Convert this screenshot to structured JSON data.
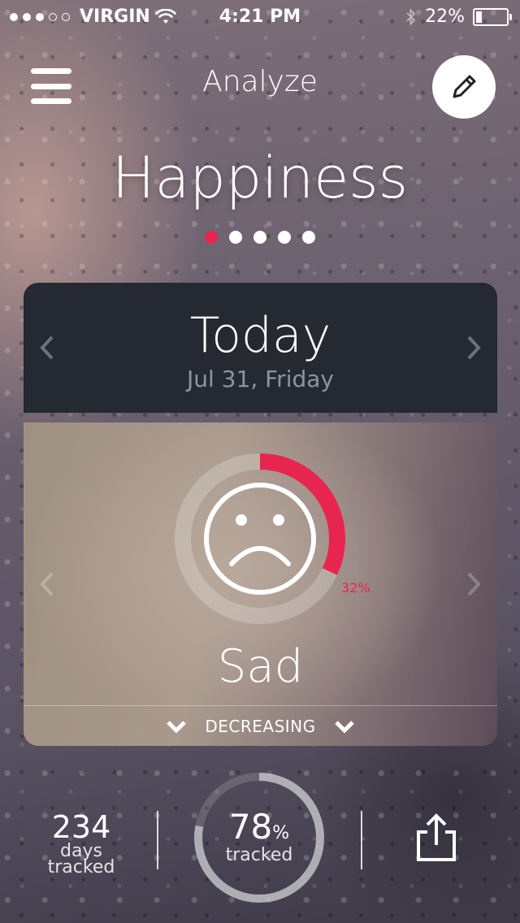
{
  "status": {
    "carrier": "VIRGIN",
    "time": "4:21 PM",
    "battery": "22%",
    "battery_level": 0.22,
    "signal_bars": 3,
    "signal_total": 5
  },
  "header": {
    "title": "Analyze",
    "menu_icon": "hamburger-menu-icon",
    "edit_icon": "pencil-icon"
  },
  "category": {
    "title": "Happiness",
    "pages": 5,
    "active_page": 1
  },
  "day_card": {
    "day": "Today",
    "date": "Jul 31, Friday"
  },
  "mood": {
    "name": "Sad",
    "icon": "sad-face-icon",
    "percent_label": "32%",
    "percent": 0.32,
    "trend_label": "DECREASING"
  },
  "stats": {
    "days_value": "234",
    "days_label_1": "days",
    "days_label_2": "tracked",
    "tracked_value": "78",
    "tracked_unit": "%",
    "tracked_label": "tracked",
    "tracked_percent": 0.78,
    "share_icon": "share-icon"
  },
  "colors": {
    "accent": "#e8254f",
    "card_dark": "#242932"
  }
}
